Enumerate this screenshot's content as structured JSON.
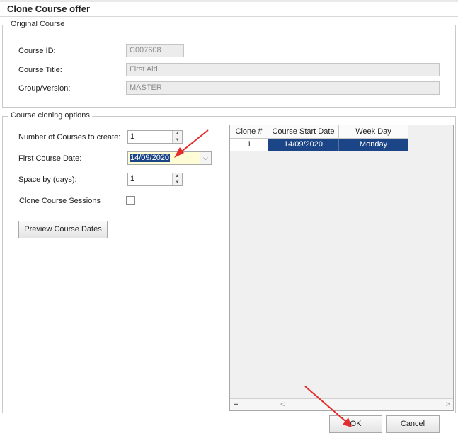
{
  "window": {
    "title": "Clone Course offer"
  },
  "original_course": {
    "legend": "Original Course",
    "course_id_label": "Course ID:",
    "course_id_value": "C007608",
    "course_title_label": "Course Title:",
    "course_title_value": "First Aid",
    "group_version_label": "Group/Version:",
    "group_version_value": "MASTER"
  },
  "cloning_options": {
    "legend": "Course cloning options",
    "num_courses_label": "Number of Courses to create:",
    "num_courses_value": "1",
    "first_date_label": "First Course Date:",
    "first_date_value": "14/09/2020",
    "space_days_label": "Space by (days):",
    "space_days_value": "1",
    "clone_sessions_label": "Clone Course Sessions",
    "preview_button": "Preview Course Dates"
  },
  "grid": {
    "columns": [
      "Clone #",
      "Course Start Date",
      "Week Day"
    ],
    "rows": [
      {
        "clone": "1",
        "start_date": "14/09/2020",
        "week_day": "Monday"
      }
    ],
    "minus_symbol": "−",
    "left_arrow": "<",
    "right_arrow": ">"
  },
  "footer": {
    "ok_label": "OK",
    "cancel_label": "Cancel"
  },
  "icons": {
    "spin_up": "▲",
    "spin_down": "▼",
    "dropdown": "⌵"
  },
  "colors": {
    "selection": "#1c4587",
    "annotation_arrow": "#e52b2b",
    "date_field_bg": "#fffdd5"
  }
}
